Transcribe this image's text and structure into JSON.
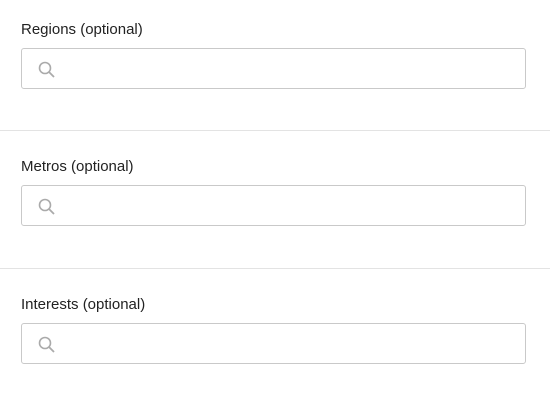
{
  "fields": [
    {
      "label": "Regions (optional)",
      "placeholder": ""
    },
    {
      "label": "Metros (optional)",
      "placeholder": ""
    },
    {
      "label": "Interests (optional)",
      "placeholder": ""
    }
  ]
}
